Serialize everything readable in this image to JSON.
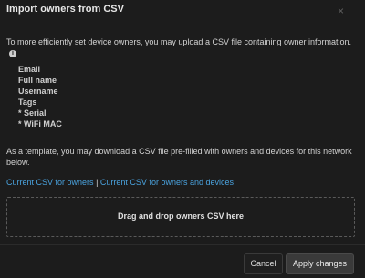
{
  "modal": {
    "title": "Import owners from CSV",
    "close_symbol": "×"
  },
  "intro": {
    "text": "To more efficiently set device owners, you may upload a CSV file containing owner information.",
    "info_icon": "info-icon"
  },
  "fields": [
    "Email",
    "Full name",
    "Username",
    "Tags",
    "* Serial",
    "* WiFi MAC"
  ],
  "template_text": "As a template, you may download a CSV file pre-filled with owners and devices for this network below.",
  "links": {
    "owners": "Current CSV for owners",
    "separator": "|",
    "owners_devices": "Current CSV for owners and devices"
  },
  "dropzone": {
    "label": "Drag and drop owners CSV here"
  },
  "footer": {
    "cancel_label": "Cancel",
    "apply_label": "Apply changes"
  },
  "colors": {
    "link": "#4aa3df",
    "background": "#1c1c1c"
  }
}
